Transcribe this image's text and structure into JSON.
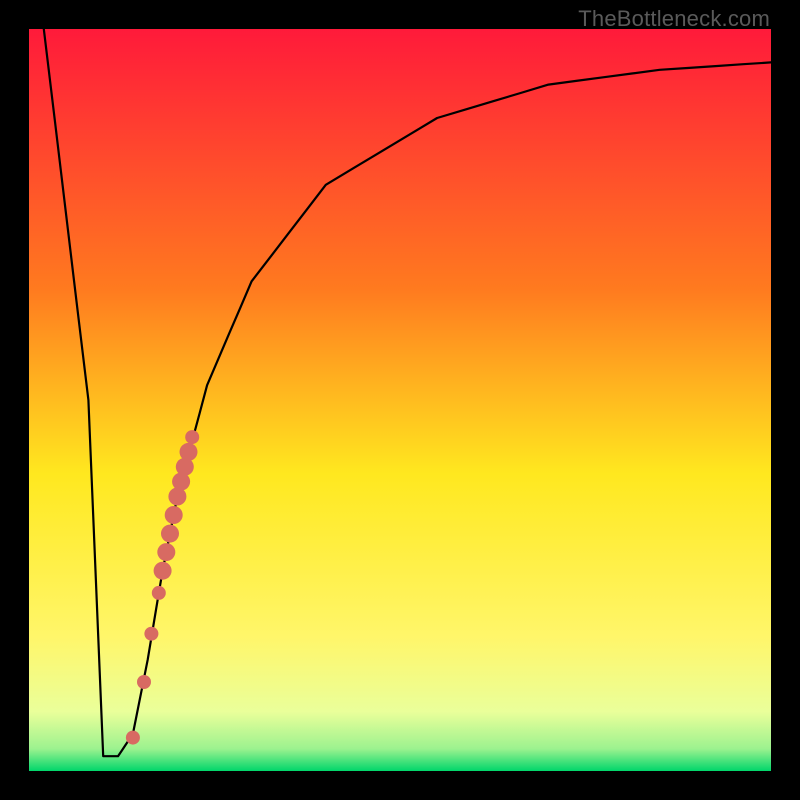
{
  "watermark": "TheBottleneck.com",
  "chart_data": {
    "type": "line",
    "title": "",
    "xlabel": "",
    "ylabel": "",
    "xlim": [
      0,
      100
    ],
    "ylim": [
      0,
      100
    ],
    "gradient_colors": {
      "top": "#ff1a3a",
      "upper_mid": "#ff9a1f",
      "mid": "#ffe81f",
      "lower_mid": "#f8ff7a",
      "near_bottom": "#cfffa8",
      "bottom": "#00d66b"
    },
    "series": [
      {
        "name": "bottleneck-curve",
        "x": [
          2,
          8,
          10,
          12,
          14,
          16,
          18,
          20,
          24,
          30,
          40,
          55,
          70,
          85,
          100
        ],
        "y": [
          100,
          50,
          2,
          2,
          5,
          15,
          27,
          37,
          52,
          66,
          79,
          88,
          92.5,
          94.5,
          95.5
        ]
      }
    ],
    "highlight_points": {
      "name": "highlighted-range",
      "color": "#d86a62",
      "points": [
        {
          "x": 14.0,
          "y": 4.5
        },
        {
          "x": 15.5,
          "y": 12.0
        },
        {
          "x": 16.5,
          "y": 18.5
        },
        {
          "x": 17.5,
          "y": 24.0
        },
        {
          "x": 18.0,
          "y": 27.0
        },
        {
          "x": 18.5,
          "y": 29.5
        },
        {
          "x": 19.0,
          "y": 32.0
        },
        {
          "x": 19.5,
          "y": 34.5
        },
        {
          "x": 20.0,
          "y": 37.0
        },
        {
          "x": 20.5,
          "y": 39.0
        },
        {
          "x": 21.0,
          "y": 41.0
        },
        {
          "x": 21.5,
          "y": 43.0
        },
        {
          "x": 22.0,
          "y": 45.0
        }
      ]
    }
  }
}
